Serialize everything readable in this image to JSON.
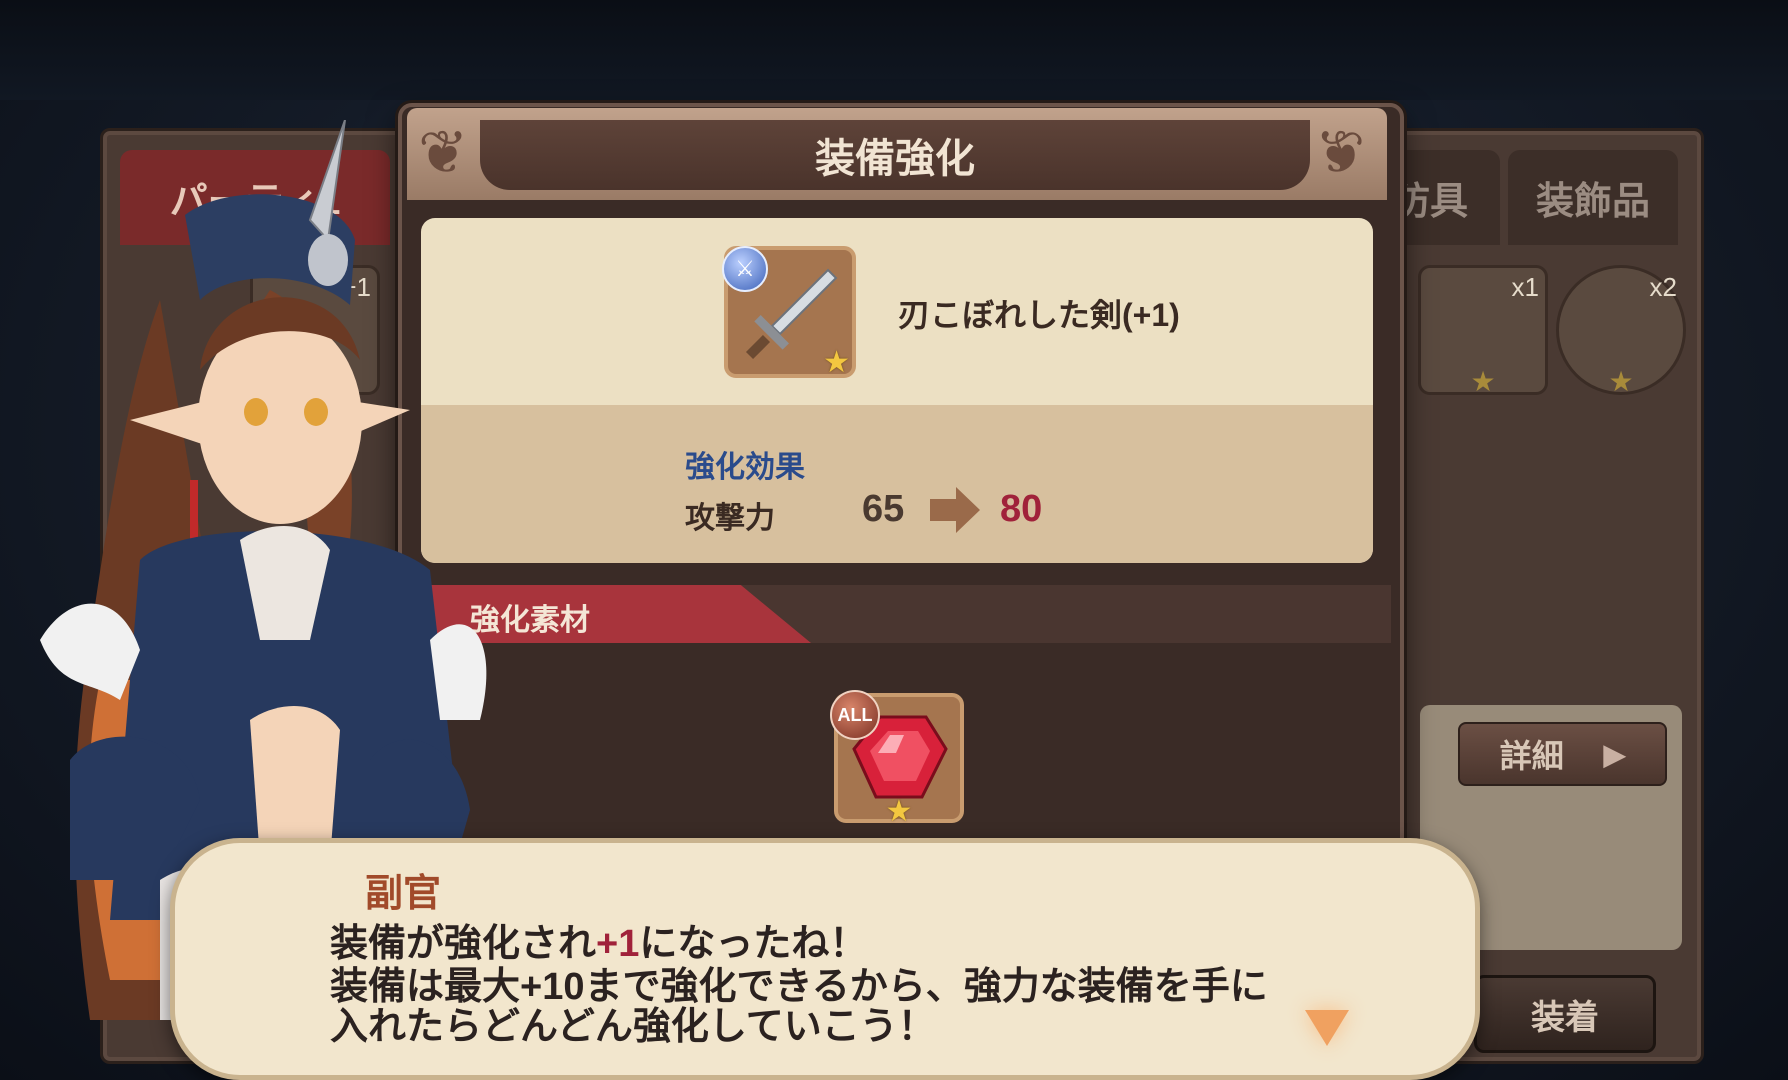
{
  "background": {
    "tabs": [
      "パーティ1",
      "防具",
      "装飾品"
    ],
    "slots": [
      {
        "count": "+1"
      },
      {
        "count": "x1"
      },
      {
        "count": "x2"
      }
    ],
    "detail_label": "詳細",
    "equip_label": "装着"
  },
  "dialog": {
    "title": "装備強化",
    "item": {
      "name": "刃こぼれした剣(+1)",
      "icon": "sword-icon",
      "rarity_icon": "star-icon"
    },
    "effect": {
      "label": "強化効果",
      "stat_name": "攻撃力",
      "old_value": "65",
      "new_value": "80"
    },
    "material": {
      "label": "強化素材",
      "badge": "ALL",
      "icon": "ruby-gem-icon"
    }
  },
  "speech": {
    "speaker": "副官",
    "line1_before": "装備が強化され",
    "line1_highlight": "+1",
    "line1_after": "になったね！",
    "line2": "装備は最大+10まで強化できるから、強力な装備を手に",
    "line3": "入れたらどんどん強化していこう！"
  },
  "colors": {
    "accent_red": "#a0223a",
    "effect_blue": "#2a4b8c",
    "panel_cream": "#ece0c3"
  }
}
